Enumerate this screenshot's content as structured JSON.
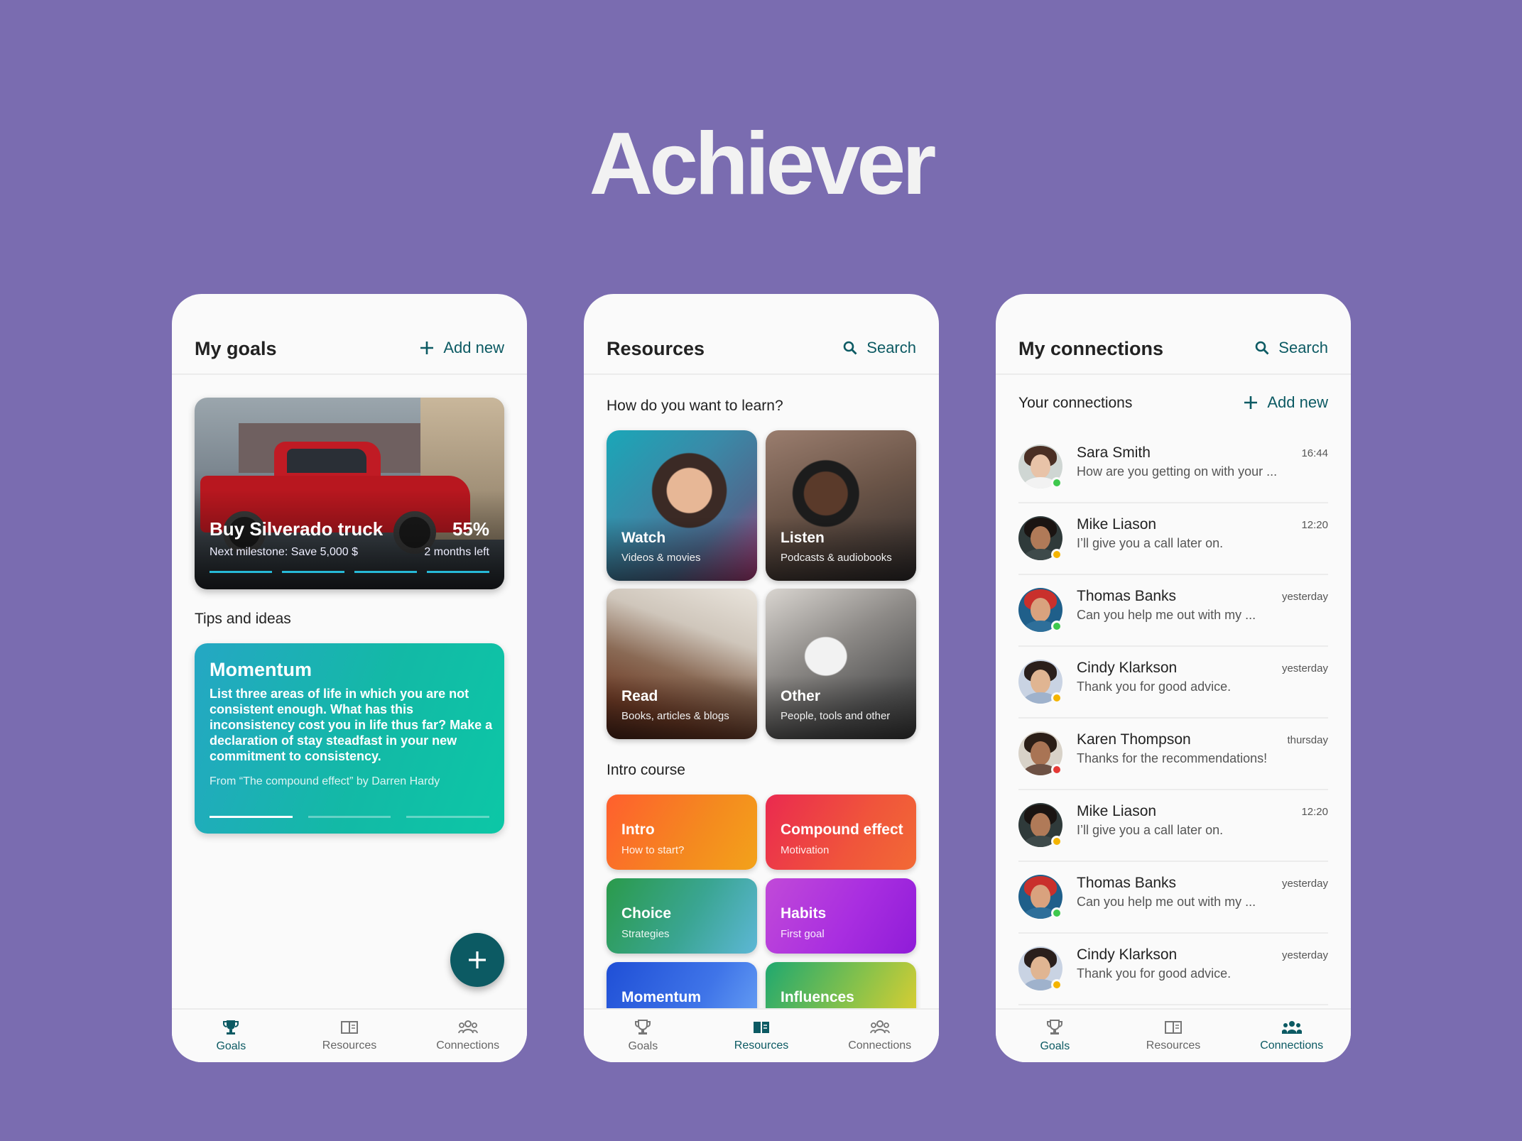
{
  "app_title": "Achiever",
  "colors": {
    "background": "#7a6cb0",
    "accent": "#0c5a63",
    "online": "#3ec84d",
    "away": "#f4b400",
    "busy": "#e53935"
  },
  "goals_screen": {
    "title": "My goals",
    "add_label": "Add new",
    "goal": {
      "name": "Buy Silverado truck",
      "percent": "55%",
      "milestone": "Next milestone: Save 5,000 $",
      "time_left": "2 months left",
      "progress_fraction": 0.55
    },
    "tips_label": "Tips and ideas",
    "tip": {
      "title": "Momentum",
      "body": "List three areas of life in which you are not consistent enough. What has this inconsistency cost you in life thus far? Make a declaration of stay steadfast in your new commitment to consistency.",
      "source": "From “The compound effect” by Darren Hardy"
    },
    "fab_icon": "plus-icon"
  },
  "resources_screen": {
    "title": "Resources",
    "search_label": "Search",
    "learn_label": "How do you want to learn?",
    "tiles": [
      {
        "title": "Watch",
        "subtitle": "Videos & movies"
      },
      {
        "title": "Listen",
        "subtitle": "Podcasts & audiobooks"
      },
      {
        "title": "Read",
        "subtitle": "Books, articles & blogs"
      },
      {
        "title": "Other",
        "subtitle": "People, tools and other"
      }
    ],
    "course_label": "Intro course",
    "courses": [
      {
        "title": "Intro",
        "subtitle": "How to start?"
      },
      {
        "title": "Compound effect",
        "subtitle": "Motivation"
      },
      {
        "title": "Choice",
        "subtitle": "Strategies"
      },
      {
        "title": "Habits",
        "subtitle": "First goal"
      },
      {
        "title": "Momentum",
        "subtitle": ""
      },
      {
        "title": "Influences",
        "subtitle": ""
      }
    ]
  },
  "connections_screen": {
    "title": "My connections",
    "search_label": "Search",
    "list_label": "Your connections",
    "add_label": "Add new",
    "contacts": [
      {
        "name": "Sara Smith",
        "message": "How are you getting on with your ...",
        "time": "16:44",
        "status": "online"
      },
      {
        "name": "Mike Liason",
        "message": "I’ll give you a call later on.",
        "time": "12:20",
        "status": "away"
      },
      {
        "name": "Thomas Banks",
        "message": "Can you help me out with my ...",
        "time": "yesterday",
        "status": "online"
      },
      {
        "name": "Cindy Klarkson",
        "message": "Thank you for good advice.",
        "time": "yesterday",
        "status": "away"
      },
      {
        "name": "Karen Thompson",
        "message": "Thanks for the recommendations!",
        "time": "thursday",
        "status": "busy"
      },
      {
        "name": "Mike Liason",
        "message": "I’ll give you a call later on.",
        "time": "12:20",
        "status": "away"
      },
      {
        "name": "Thomas Banks",
        "message": "Can you help me out with my ...",
        "time": "yesterday",
        "status": "online"
      },
      {
        "name": "Cindy Klarkson",
        "message": "Thank you for good advice.",
        "time": "yesterday",
        "status": "away"
      }
    ]
  },
  "nav": {
    "goals": "Goals",
    "resources": "Resources",
    "connections": "Connections"
  }
}
